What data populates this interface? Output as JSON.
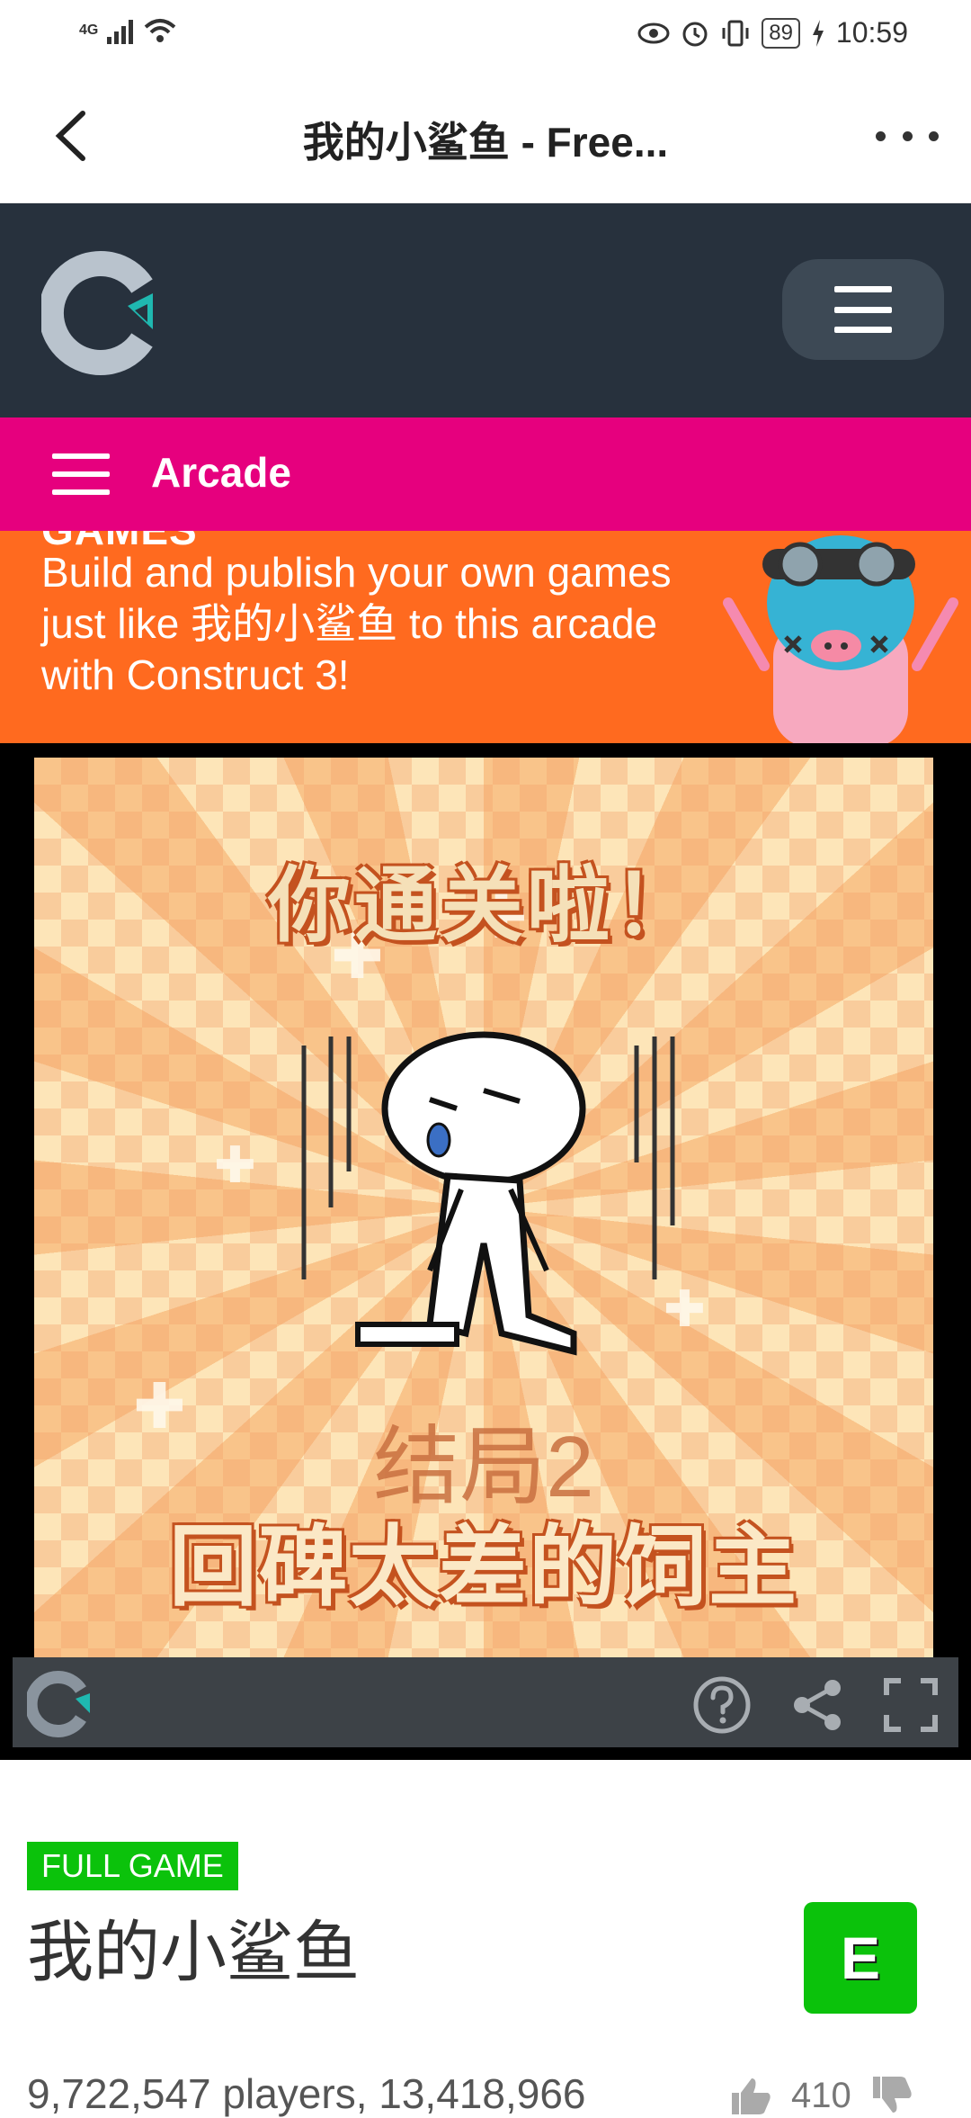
{
  "status_bar": {
    "network": "4G",
    "wifi_label": "4",
    "battery": "89",
    "time": "10:59"
  },
  "app_bar": {
    "title": "我的小鲨鱼 - Free..."
  },
  "nav": {
    "arcade_label": "Arcade"
  },
  "promo": {
    "heading_partial": "GAMES",
    "text": "Build and publish your own games just like 我的小鲨鱼 to this arcade with Construct 3!"
  },
  "game_screen": {
    "headline": "你通关啦！",
    "ending_label": "结局2",
    "ending_title": "回碑太差的饲主"
  },
  "game_info": {
    "badge": "FULL GAME",
    "title": "我的小鲨鱼",
    "rating": "E",
    "stats": "9,722,547 players, 13,418,966",
    "likes": "410"
  },
  "colors": {
    "header_bg": "#27313d",
    "arcade_nav_bg": "#e6007e",
    "promo_bg": "#ff6a1f",
    "badge_green": "#0bc20b"
  }
}
